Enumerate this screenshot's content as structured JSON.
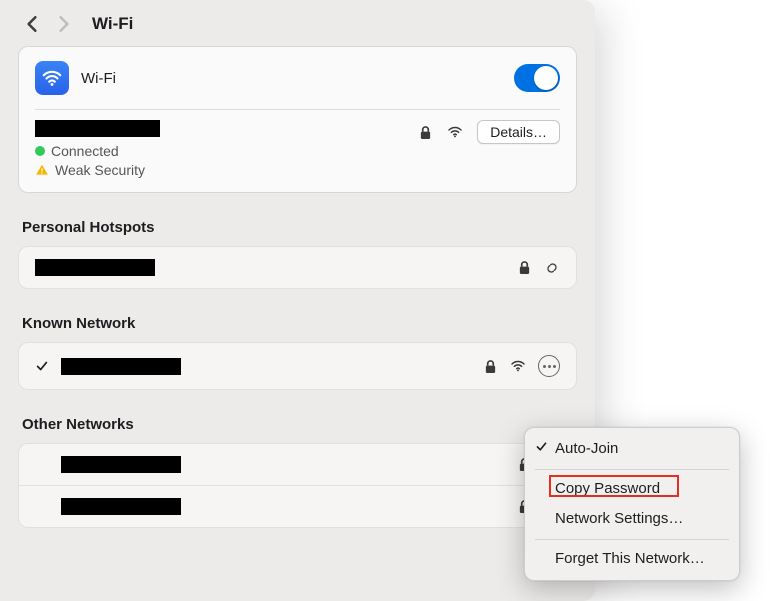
{
  "header": {
    "title": "Wi-Fi"
  },
  "wifi_card": {
    "title": "Wi-Fi",
    "toggle_on": true,
    "connected_label": "Connected",
    "security_label": "Weak Security",
    "details_label": "Details…"
  },
  "sections": {
    "personal_hotspots": "Personal Hotspots",
    "known_network": "Known Network",
    "other_networks": "Other Networks"
  },
  "context_menu": {
    "auto_join": "Auto-Join",
    "copy_password": "Copy Password",
    "network_settings": "Network Settings…",
    "forget": "Forget This Network…"
  }
}
